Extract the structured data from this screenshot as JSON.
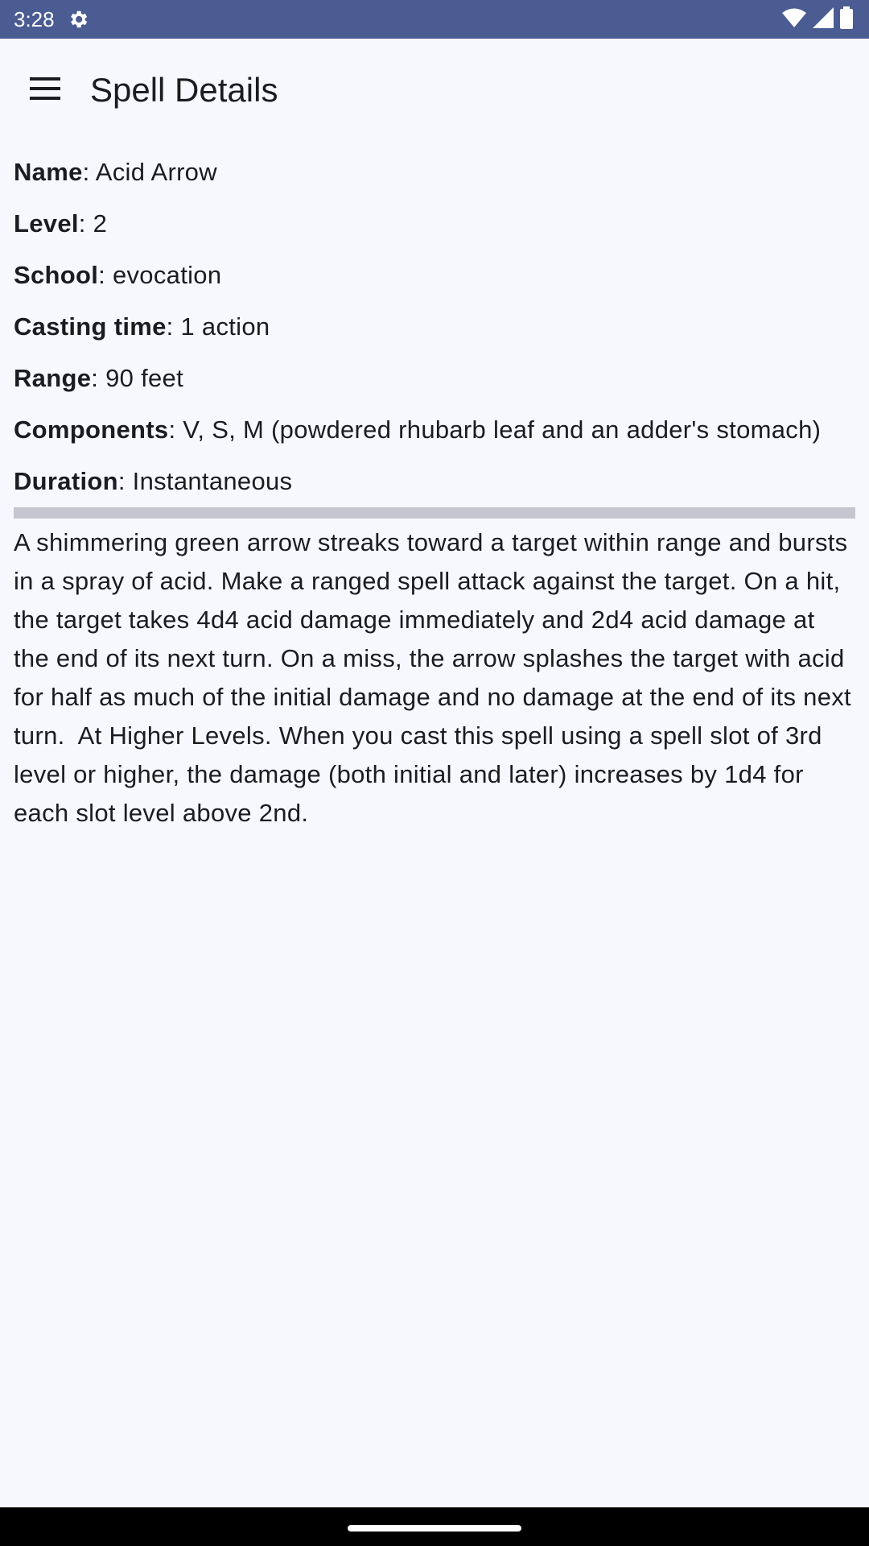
{
  "status_bar": {
    "time": "3:28",
    "icons": [
      "settings-gear-icon",
      "wifi-icon",
      "signal-icon",
      "battery-icon"
    ]
  },
  "app_bar": {
    "menu_icon": "hamburger-menu-icon",
    "title": "Spell Details"
  },
  "spell": {
    "fields": [
      {
        "label": "Name",
        "value": ": Acid Arrow"
      },
      {
        "label": "Level",
        "value": ": 2"
      },
      {
        "label": "School",
        "value": ": evocation"
      },
      {
        "label": "Casting time",
        "value": ": 1 action"
      },
      {
        "label": "Range",
        "value": ": 90 feet"
      },
      {
        "label": "Components",
        "value": ": V, S, M (powdered rhubarb leaf and an adder's stomach)"
      },
      {
        "label": "Duration",
        "value": ": Instantaneous"
      }
    ],
    "description": "A shimmering green arrow streaks toward a target within range and bursts in a spray of acid. Make a ranged spell attack against the target. On a hit, the target takes 4d4 acid damage immediately and 2d4 acid damage at the end of its next turn. On a miss, the arrow splashes the target with acid for half as much of the initial damage and no damage at the end of its next turn.  At Higher Levels. When you cast this spell using a spell slot of 3rd level or higher, the damage (both initial and later) increases by 1d4 for each slot level above 2nd."
  },
  "colors": {
    "status_bar": "#4b5c92",
    "background": "#f7f8fe",
    "divider": "#c5c6d0",
    "text": "#1b1c22"
  }
}
